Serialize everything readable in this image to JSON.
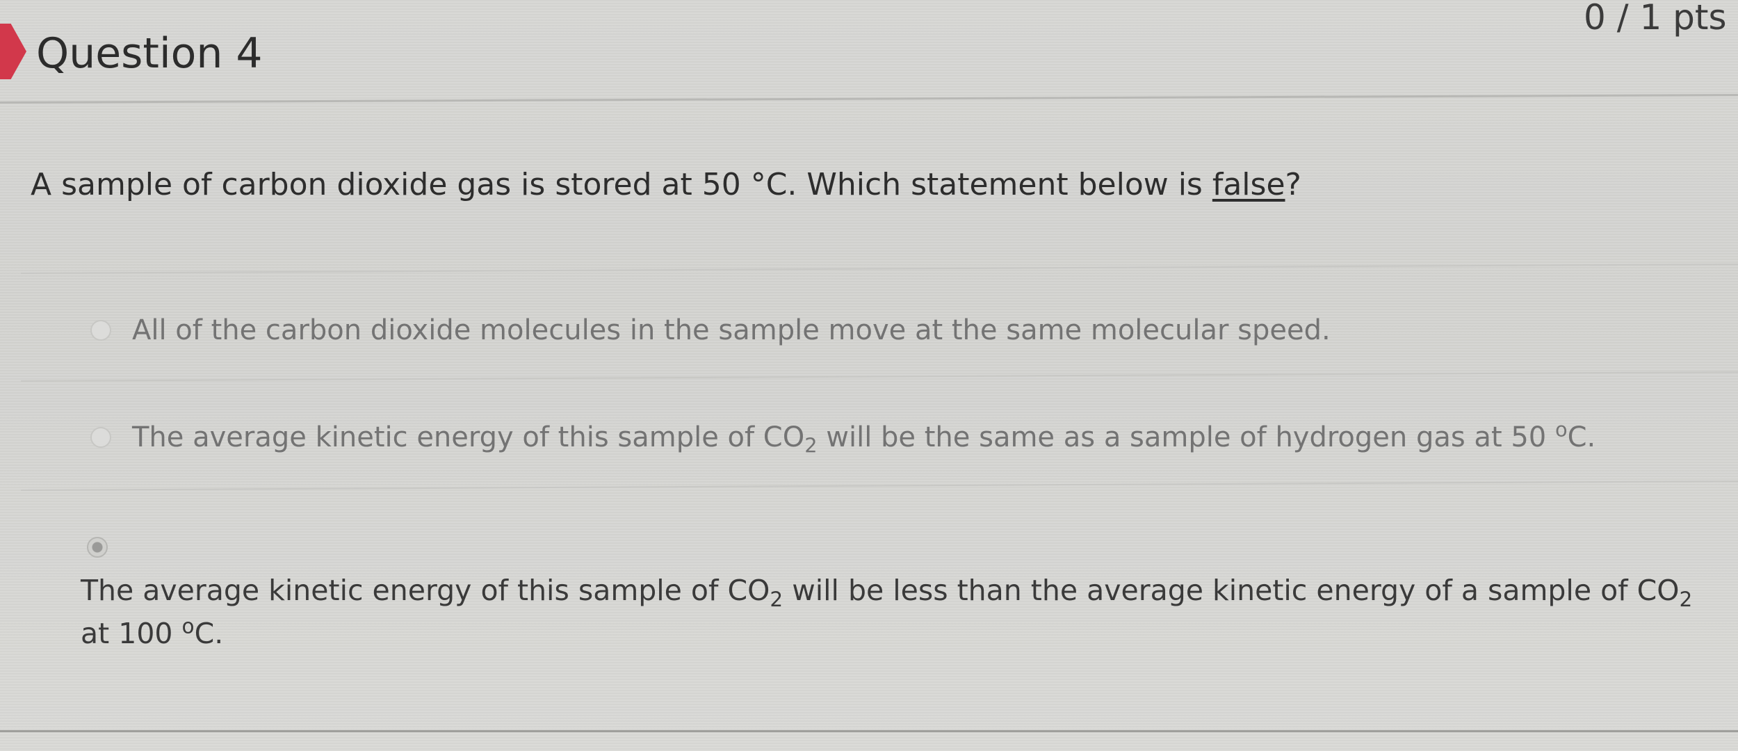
{
  "header": {
    "question_title": "Question 4",
    "points": "0 / 1 pts"
  },
  "question": {
    "prompt_before": "A sample of carbon dioxide gas is stored at 50 °C.  Which statement below is ",
    "prompt_emphasis": "false",
    "prompt_after": "?"
  },
  "answers": [
    {
      "selected": false,
      "text": "All of the carbon dioxide molecules in the sample move at the same molecular speed."
    },
    {
      "selected": false,
      "text_part1": "The average kinetic energy of this sample of CO",
      "sub1": "2",
      "text_part2": " will be the same as a sample of hydrogen gas at 50 ",
      "sup1": "o",
      "text_part3": "C."
    },
    {
      "selected": true,
      "text_part1": "The average kinetic energy of this sample of CO",
      "sub1": "2",
      "text_part2": " will be less than the average kinetic energy of a sample of CO",
      "sub2": "2",
      "text_part3": " at 100 ",
      "sup1": "o",
      "text_part4": "C."
    }
  ]
}
